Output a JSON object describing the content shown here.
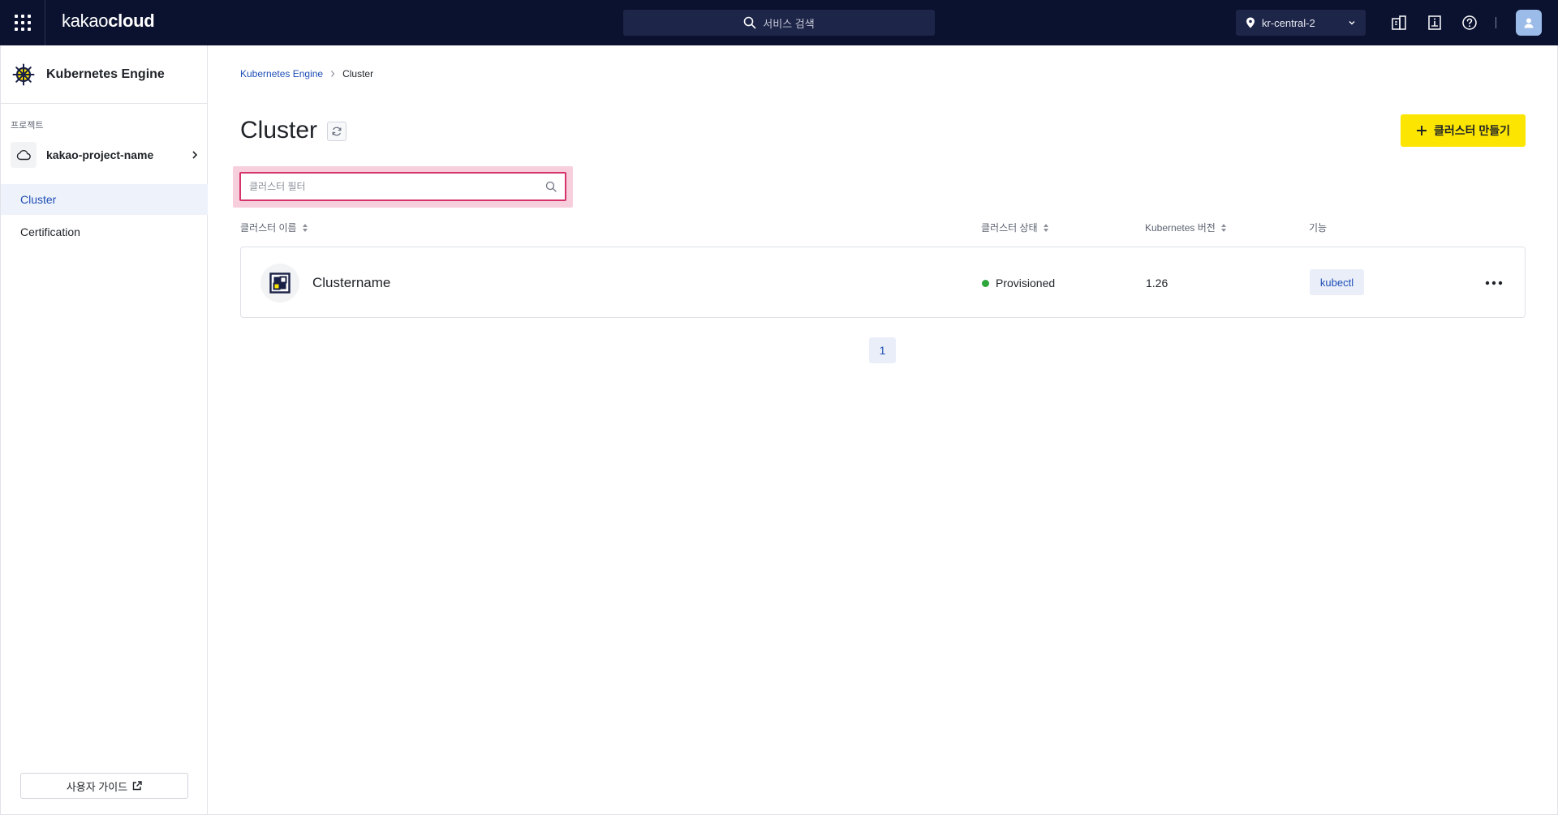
{
  "topbar": {
    "brand_light": "kakao",
    "brand_bold": "cloud",
    "search_placeholder": "서비스 검색",
    "region": "kr-central-2"
  },
  "sidebar": {
    "service_title": "Kubernetes Engine",
    "project_label": "프로젝트",
    "project_name": "kakao-project-name",
    "items": [
      {
        "label": "Cluster",
        "active": true
      },
      {
        "label": "Certification",
        "active": false
      }
    ],
    "guide_label": "사용자 가이드"
  },
  "main": {
    "breadcrumb": [
      "Kubernetes Engine",
      "Cluster"
    ],
    "title": "Cluster",
    "create_button": "클러스터 만들기",
    "filter_placeholder": "클러스터 필터",
    "columns": [
      "클러스터 이름",
      "클러스터 상태",
      "Kubernetes 버전",
      "기능"
    ],
    "rows": [
      {
        "name": "Clustername",
        "status": "Provisioned",
        "version": "1.26",
        "feature": "kubectl"
      }
    ],
    "pagination": {
      "current": "1"
    }
  },
  "colors": {
    "topbar_bg": "#0b1230",
    "accent_yellow": "#fce500",
    "link_blue": "#1f4fb6",
    "status_green": "#2ea63a",
    "highlight_pink": "#d6336c"
  }
}
